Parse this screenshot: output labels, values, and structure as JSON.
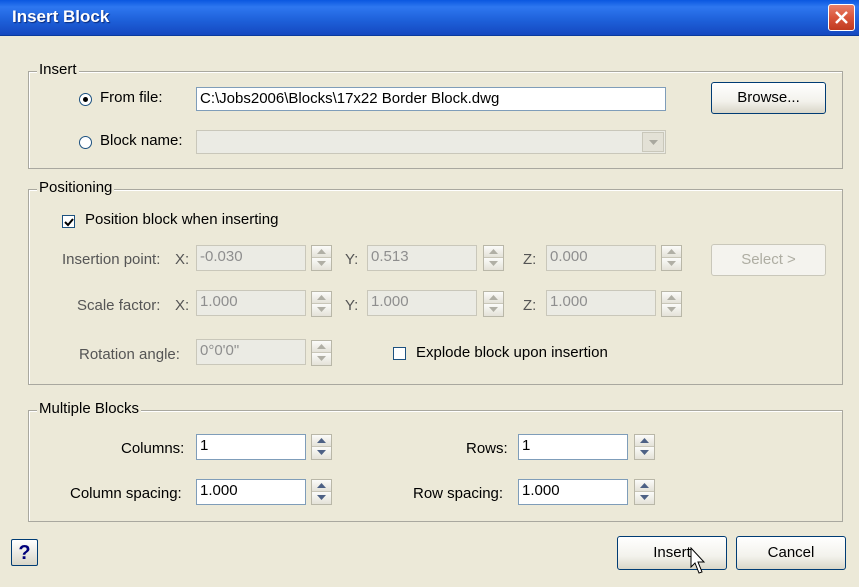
{
  "window": {
    "title": "Insert Block"
  },
  "insert": {
    "legend": "Insert",
    "from_file_label": "From file:",
    "from_file_value": "C:\\Jobs2006\\Blocks\\17x22 Border Block.dwg",
    "browse_label": "Browse...",
    "block_name_label": "Block name:",
    "block_name_value": "",
    "selected": "from_file"
  },
  "positioning": {
    "legend": "Positioning",
    "position_label": "Position block when inserting",
    "position_checked": true,
    "insertion_point_label": "Insertion point:",
    "x_label": "X:",
    "y_label": "Y:",
    "z_label": "Z:",
    "insertion_x": "-0.030",
    "insertion_y": "0.513",
    "insertion_z": "0.000",
    "select_label": "Select >",
    "scale_factor_label": "Scale factor:",
    "scale_x": "1.000",
    "scale_y": "1.000",
    "scale_z": "1.000",
    "rotation_label": "Rotation angle:",
    "rotation_value": "0°0'0\"",
    "explode_label": "Explode block upon insertion",
    "explode_checked": false
  },
  "multiple": {
    "legend": "Multiple Blocks",
    "columns_label": "Columns:",
    "columns_value": "1",
    "rows_label": "Rows:",
    "rows_value": "1",
    "col_spacing_label": "Column spacing:",
    "col_spacing_value": "1.000",
    "row_spacing_label": "Row spacing:",
    "row_spacing_value": "1.000"
  },
  "footer": {
    "help_label": "?",
    "insert_label": "Insert",
    "cancel_label": "Cancel"
  },
  "colors": {
    "titlebar": "#1D5FD8",
    "close_button": "#D9553A",
    "dialog_bg": "#ECE9D8"
  },
  "icons": [
    "close-icon",
    "spin-up-icon",
    "spin-down-icon",
    "chevron-down-icon",
    "checkmark-icon",
    "help-icon",
    "mouse-cursor-icon"
  ]
}
